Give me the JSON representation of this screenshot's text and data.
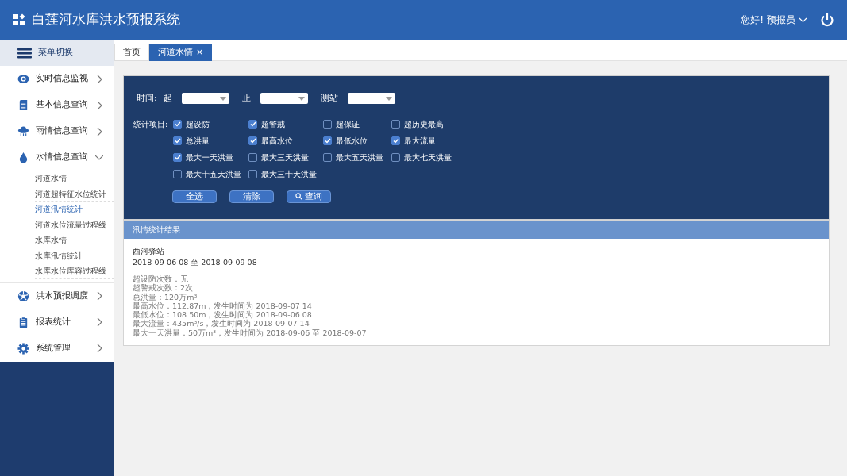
{
  "header": {
    "title": "白莲河水库洪水预报系统",
    "greeting": "您好!",
    "user": "预报员"
  },
  "sidebar": {
    "toggle": "菜单切换",
    "items": [
      {
        "label": "实时信息监视",
        "expanded": false
      },
      {
        "label": "基本信息查询",
        "expanded": false
      },
      {
        "label": "雨情信息查询",
        "expanded": false
      },
      {
        "label": "水情信息查询",
        "expanded": true,
        "children": [
          {
            "label": "河道水情",
            "selected": false
          },
          {
            "label": "河道超特征水位统计",
            "selected": false
          },
          {
            "label": "河道汛情统计",
            "selected": true
          },
          {
            "label": "河道水位流量过程线",
            "selected": false
          },
          {
            "label": "水库水情",
            "selected": false
          },
          {
            "label": "水库汛情统计",
            "selected": false
          },
          {
            "label": "水库水位库容过程线",
            "selected": false
          }
        ]
      },
      {
        "label": "洪水预报调度",
        "expanded": false
      },
      {
        "label": "报表统计",
        "expanded": false
      },
      {
        "label": "系统管理",
        "expanded": false
      }
    ]
  },
  "tabs": [
    {
      "label": "首页",
      "selected": false
    },
    {
      "label": "河道水情",
      "selected": true,
      "close": "×"
    }
  ],
  "filter": {
    "time_label": "时间:",
    "start_label": "起",
    "end_label": "止",
    "station_label": "测站",
    "items_label": "统计项目:",
    "items": [
      {
        "label": "超设防",
        "checked": true
      },
      {
        "label": "超警戒",
        "checked": true
      },
      {
        "label": "超保证",
        "checked": false
      },
      {
        "label": "超历史最高",
        "checked": false
      },
      {
        "label": "总洪量",
        "checked": true
      },
      {
        "label": "最高水位",
        "checked": true
      },
      {
        "label": "最低水位",
        "checked": true
      },
      {
        "label": "最大流量",
        "checked": true
      },
      {
        "label": "最大一天洪量",
        "checked": true
      },
      {
        "label": "最大三天洪量",
        "checked": false
      },
      {
        "label": "最大五天洪量",
        "checked": false
      },
      {
        "label": "最大七天洪量",
        "checked": false
      },
      {
        "label": "最大十五天洪量",
        "checked": false
      },
      {
        "label": "最大三十天洪量",
        "checked": false
      }
    ],
    "buttons": [
      {
        "label": "全选",
        "kind": "plain"
      },
      {
        "label": "清除",
        "kind": "plain"
      },
      {
        "label": "查询",
        "kind": "search"
      }
    ]
  },
  "results": {
    "title": "汛情统计结果",
    "station": "西河驿站",
    "period": "2018-09-06 08 至 2018-09-09 08",
    "lines": [
      "超设防次数：无",
      "超警戒次数：2次",
      "总洪量：120万m³",
      "最高水位：112.87m，发生时间为 2018-09-07 14",
      "最低水位：108.50m，发生时间为 2018-09-06 08",
      "最大流量：435m³/s，发生时间为 2018-09-07 14",
      "最大一天洪量：50万m³，发生时间为 2018-09-06  至 2018-09-07"
    ]
  }
}
